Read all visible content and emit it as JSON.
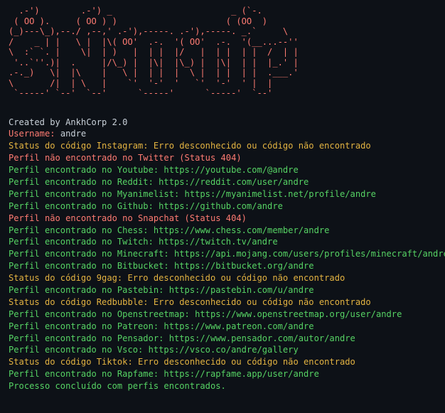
{
  "window": {
    "banner_art": "  .-')        .-') _                       _ (`-.\n ( OO ).     ( OO ) )                     ( (OO  )\n(_)---\\_),--./ ,--,' .-'),-----. .-'),-----. _.`     \\\n/    _ | |   \\ |  |\\( OO'  .-.  '( OO'  .-.  '(__...--''\n\\  :` `. |    \\|  | )   |  | |  |/   |  | |  | |  /  | |\n '..`''.)|  .     |/\\_) |  |\\|  |\\_) |  |\\|  | |  |_.' |\n.-._)   \\|  |\\    |   \\ |  | |  |  \\ |  | |  | |  .___.'\n\\       /|  | \\   |    `'  '-'  '   `'  '-'  ' |  |\n `-----' `--'  `--'      `-----'      `-----'  `--'",
    "credit": "Created by AnkhCorp 2.0",
    "username_label": "Username:",
    "username_value": "andre",
    "lines": [
      {
        "kind": "error",
        "text": "Status do código Instagram: Erro desconhecido ou código não encontrado"
      },
      {
        "kind": "notfound",
        "text": "Perfil não encontrado no Twitter (Status 404)"
      },
      {
        "kind": "found",
        "text": "Perfil encontrado no Youtube: https://youtube.com/@andre"
      },
      {
        "kind": "found",
        "text": "Perfil encontrado no Reddit: https://reddit.com/user/andre"
      },
      {
        "kind": "found",
        "text": "Perfil encontrado no Myanimelist: https://myanimelist.net/profile/andre"
      },
      {
        "kind": "found",
        "text": "Perfil encontrado no Github: https://github.com/andre"
      },
      {
        "kind": "notfound",
        "text": "Perfil não encontrado no Snapchat (Status 404)"
      },
      {
        "kind": "found",
        "text": "Perfil encontrado no Chess: https://www.chess.com/member/andre"
      },
      {
        "kind": "found",
        "text": "Perfil encontrado no Twitch: https://twitch.tv/andre"
      },
      {
        "kind": "found",
        "text": "Perfil encontrado no Minecraft: https://api.mojang.com/users/profiles/minecraft/andre"
      },
      {
        "kind": "found",
        "text": "Perfil encontrado no Bitbucket: https://bitbucket.org/andre"
      },
      {
        "kind": "error",
        "text": "Status do código 9gag: Erro desconhecido ou código não encontrado"
      },
      {
        "kind": "found",
        "text": "Perfil encontrado no Pastebin: https://pastebin.com/u/andre"
      },
      {
        "kind": "error",
        "text": "Status do código Redbubble: Erro desconhecido ou código não encontrado"
      },
      {
        "kind": "found",
        "text": "Perfil encontrado no Openstreetmap: https://www.openstreetmap.org/user/andre"
      },
      {
        "kind": "found",
        "text": "Perfil encontrado no Patreon: https://www.patreon.com/andre"
      },
      {
        "kind": "found",
        "text": "Perfil encontrado no Pensador: https://www.pensador.com/autor/andre"
      },
      {
        "kind": "found",
        "text": "Perfil encontrado no Vsco: https://vsco.co/andre/gallery"
      },
      {
        "kind": "error",
        "text": "Status do código Tiktok: Erro desconhecido ou código não encontrado"
      },
      {
        "kind": "found",
        "text": "Perfil encontrado no Rapfame: https://rapfame.app/user/andre"
      }
    ],
    "final_message": "Processo concluído com perfis encontrados."
  },
  "colors": {
    "background": "#0d1117",
    "default_text": "#c9d1d9",
    "banner": "#ff7b72",
    "found": "#56d364",
    "not_found": "#ff7b72",
    "error": "#e3b341"
  }
}
